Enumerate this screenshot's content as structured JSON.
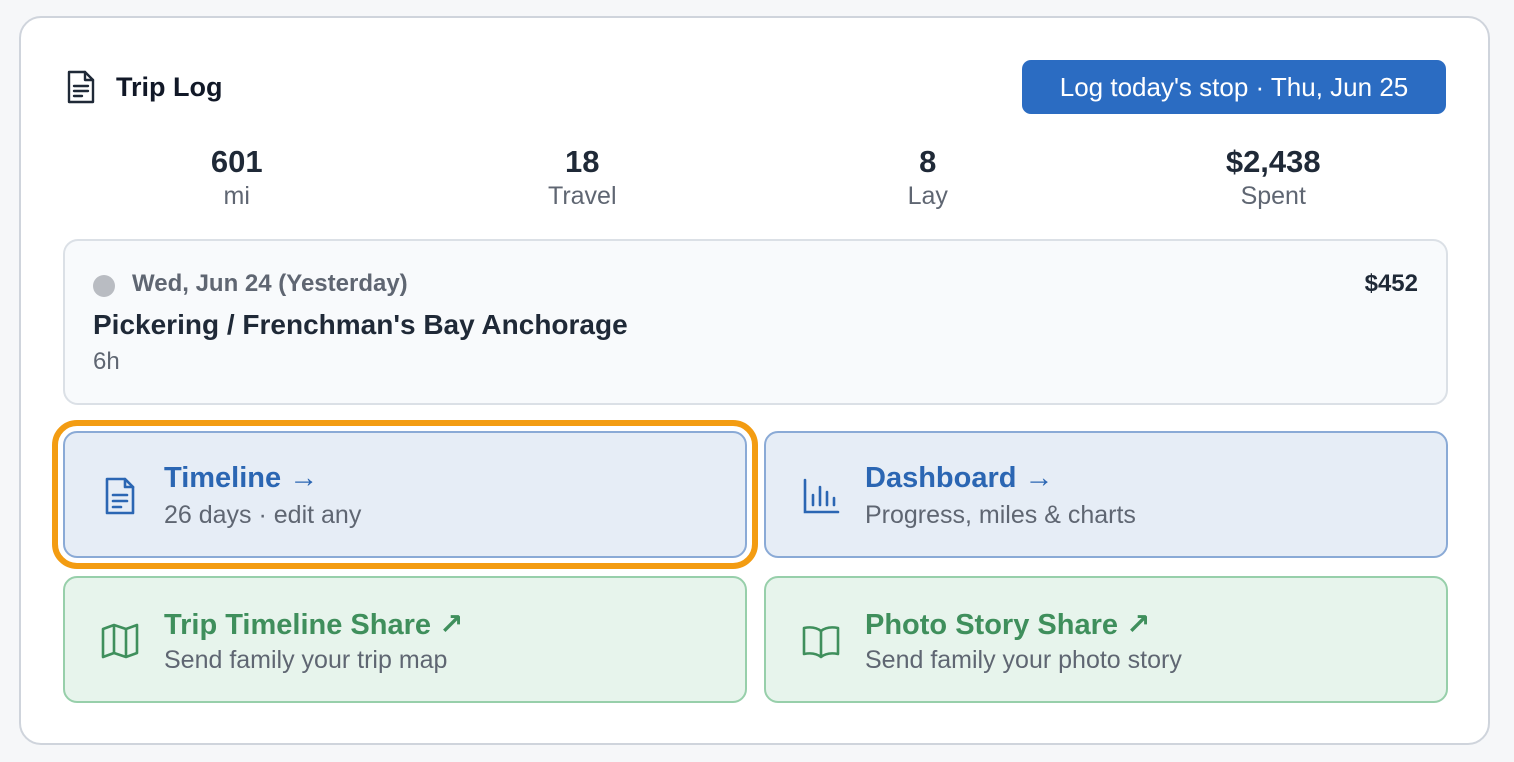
{
  "header": {
    "title": "Trip Log",
    "log_button_label": "Log today's stop · Thu, Jun 25"
  },
  "stats": [
    {
      "value": "601",
      "label": "mi"
    },
    {
      "value": "18",
      "label": "Travel"
    },
    {
      "value": "8",
      "label": "Lay"
    },
    {
      "value": "$2,438",
      "label": "Spent"
    }
  ],
  "latest_entry": {
    "date": "Wed, Jun 24 (Yesterday)",
    "place": "Pickering / Frenchman's Bay Anchorage",
    "duration": "6h",
    "amount": "$452"
  },
  "tiles": {
    "timeline": {
      "title": "Timeline",
      "arrow": "→",
      "subtitle": "26 days · edit any"
    },
    "dashboard": {
      "title": "Dashboard",
      "arrow": "→",
      "subtitle": "Progress, miles & charts"
    },
    "trip_share": {
      "title": "Trip Timeline Share",
      "arrow": "↗",
      "subtitle": "Send family your trip map"
    },
    "photo_share": {
      "title": "Photo Story Share",
      "arrow": "↗",
      "subtitle": "Send family your photo story"
    }
  },
  "colors": {
    "primary": "#2b6cc2",
    "focus_outline": "#f39c12",
    "blue_tile_bg": "#e6edf6",
    "green_tile_bg": "#e7f4ec",
    "green_text": "#3f8f5c"
  },
  "icons": {
    "title": "document-icon",
    "timeline": "document-icon",
    "dashboard": "bar-chart-icon",
    "trip_share": "map-icon",
    "photo_share": "open-book-icon"
  }
}
